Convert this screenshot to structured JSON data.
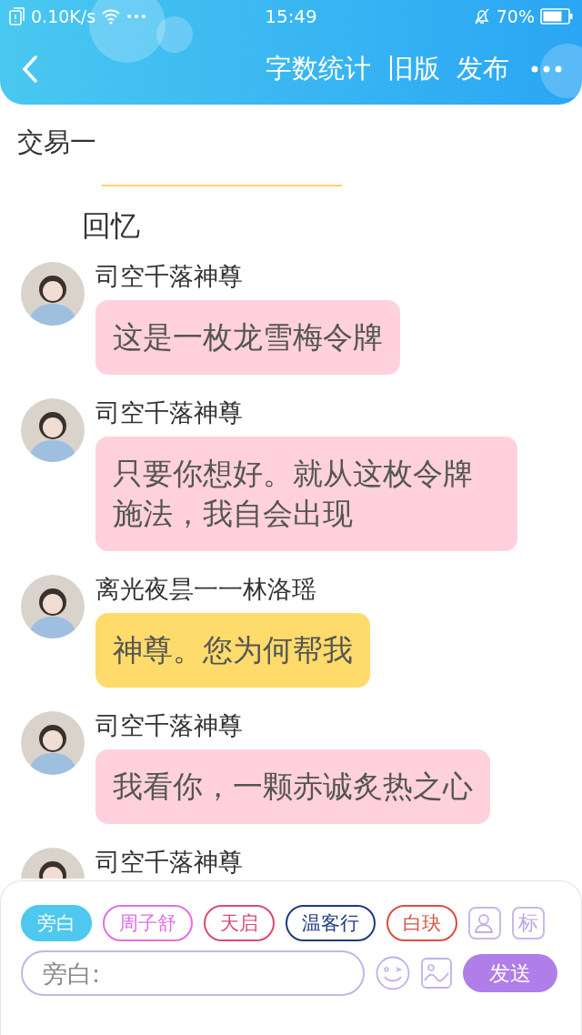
{
  "status_bar": {
    "network_speed": "0.10K/s",
    "time": "15:49",
    "battery": "70%"
  },
  "header": {
    "actions": [
      "字数统计",
      "旧版",
      "发布"
    ]
  },
  "document": {
    "title": "交易一",
    "section": "回忆"
  },
  "messages": [
    {
      "speaker": "司空千落神尊",
      "text": "这是一枚龙雪梅令牌",
      "color": "#ffd1dc"
    },
    {
      "speaker": "司空千落神尊",
      "text": "只要你想好。就从这枚令牌施法，我自会出现",
      "color": "#ffd1dc"
    },
    {
      "speaker": "离光夜昙一一林洛瑶",
      "text": "神尊。您为何帮我",
      "color": "#fedb6b"
    },
    {
      "speaker": "司空千落神尊",
      "text": "我看你，一颗赤诚炙热之心",
      "color": "#ffd1dc"
    },
    {
      "speaker": "司空千落神尊"
    }
  ],
  "roles": [
    {
      "label": "旁白",
      "selected": true,
      "color": "#4ec8ee"
    },
    {
      "label": "周子舒",
      "selected": false,
      "color": "#e36ee6"
    },
    {
      "label": "天启",
      "selected": false,
      "color": "#d94b75"
    },
    {
      "label": "温客行",
      "selected": false,
      "color": "#1e3a80"
    },
    {
      "label": "白玦",
      "selected": false,
      "color": "#d9503f"
    }
  ],
  "role_tools": {
    "tag": "标"
  },
  "composer": {
    "placeholder": "旁白:",
    "send": "发送"
  }
}
